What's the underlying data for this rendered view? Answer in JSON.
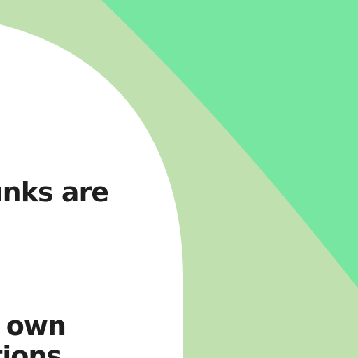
{
  "content": {
    "lines": [
      "unks are",
      "r own",
      "tions"
    ]
  },
  "colors": {
    "outer_background": "#c0e0b0",
    "accent_green": "#76e6a0",
    "card_background": "#ffffff",
    "text": "#1f1f1f"
  }
}
